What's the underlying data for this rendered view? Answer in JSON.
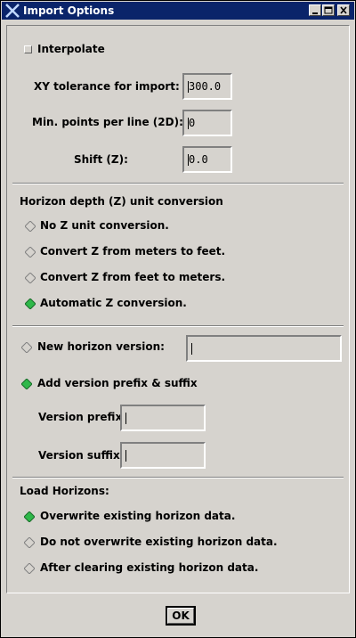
{
  "window": {
    "title": "Import Options"
  },
  "interpolate": {
    "label": "Interpolate",
    "checked": false
  },
  "fields": {
    "xy_tolerance": {
      "label": "XY tolerance for import:",
      "value": "300.0"
    },
    "min_points": {
      "label": "Min. points per line (2D):",
      "value": "0"
    },
    "shift_z": {
      "label": "Shift (Z):",
      "value": "0.0"
    }
  },
  "z_unit": {
    "heading": "Horizon depth (Z) unit conversion",
    "options": [
      {
        "label": "No Z unit conversion.",
        "selected": false
      },
      {
        "label": "Convert Z from meters to feet.",
        "selected": false
      },
      {
        "label": "Convert Z from feet to meters.",
        "selected": false
      },
      {
        "label": "Automatic Z conversion.",
        "selected": true
      }
    ]
  },
  "version": {
    "new_label": "New horizon version:",
    "new_value": "",
    "new_selected": false,
    "prefix_suffix_label": "Add version prefix & suffix",
    "prefix_suffix_selected": true,
    "prefix_label": "Version prefix:",
    "prefix_value": "",
    "suffix_label": "Version suffix:",
    "suffix_value": ""
  },
  "load": {
    "heading": "Load Horizons:",
    "options": [
      {
        "label": "Overwrite existing horizon data.",
        "selected": true
      },
      {
        "label": "Do not overwrite existing horizon data.",
        "selected": false
      },
      {
        "label": "After clearing existing horizon data.",
        "selected": false
      }
    ]
  },
  "ok_label": "OK",
  "colors": {
    "title_bg": "#0a246a",
    "selected_radio": "#2fb84a",
    "background": "#d6d3ce"
  }
}
